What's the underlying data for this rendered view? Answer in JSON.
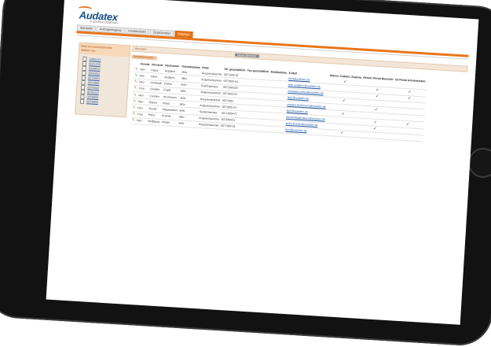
{
  "app": {
    "brand": "Audatex",
    "subtitle": "A SOLERA COMPANY"
  },
  "tabs": [
    "Startseite",
    "Auftragseingang",
    "Kundendaten",
    "Zusatzkosten",
    "Kataloge"
  ],
  "sidebar": {
    "header_line1": "Bitte bei untenstehenden",
    "header_line2": "Wählen Sie",
    "items": [
      "0000123",
      "0021235",
      "0036624",
      "0041053",
      "0072664",
      "0073305",
      "0074422",
      "0076313",
      "0078005",
      "0078899"
    ]
  },
  "main": {
    "panel_title": "Benutzer",
    "button_label": "Neuen Benutzer",
    "subheader": "Kontaktpersonen",
    "columns": [
      "",
      "Anrede",
      "Vorname",
      "Nachname",
      "Kontaktstatus",
      "Rolle",
      "Tel. geschäftlich",
      "Fax geschäftlich",
      "Mobiltelefon",
      "E-Mail",
      "Aktiver Audatex Zugang",
      "Aktiver Portal Benutzer",
      "Ist Portal Administrator"
    ],
    "rows": [
      {
        "anrede": "Herr",
        "vorname": "Klaus",
        "nachname": "Andljeric",
        "status": "aktiv",
        "rolle": "Ansprechpartner",
        "tel": "0071905-01",
        "email": "fsch@audatex.de",
        "a": true,
        "b": false,
        "c": false
      },
      {
        "anrede": "Herr",
        "vorname": "Hans",
        "nachname": "Andljeric",
        "status": "aktiv",
        "rolle": "Ansprechpartner",
        "tel": "0071905-01",
        "email": "web.andljeric@audatex.de",
        "a": false,
        "b": true,
        "c": true
      },
      {
        "anrede": "Herr",
        "vorname": "Christoph",
        "nachname": "Carlus",
        "status": "aktiv",
        "rolle": "Chefingenieur",
        "tel": "0071905287",
        "email": "christoph.carlus@audatex.de",
        "a": false,
        "b": true,
        "c": true
      },
      {
        "anrede": "Frau",
        "vorname": "Cordela",
        "nachname": "Engel",
        "status": "aktiv",
        "rolle": "Ansprechpartner",
        "tel": "0071905-01",
        "email": "fsch@audatex.de",
        "a": true,
        "b": false,
        "c": false
      },
      {
        "anrede": "Herr",
        "vorname": "Carsten",
        "nachname": "Hochmann",
        "status": "aktiv",
        "rolle": "Ansprechpartner",
        "tel": "0071905",
        "email": "carsten.hochmann@audatex.de",
        "a": false,
        "b": true,
        "c": false
      },
      {
        "anrede": "Herr",
        "vorname": "Rainer",
        "nachname": "Klaus",
        "status": "aktiv",
        "rolle": "Ansprechpartner",
        "tel": "0071905-01",
        "email": "fsch@audatex.de",
        "a": true,
        "b": false,
        "c": false
      },
      {
        "anrede": "Herr",
        "vorname": "Daniel",
        "nachname": "Klippenstein",
        "status": "aktiv",
        "rolle": "Systemberater",
        "tel": "0071905471",
        "email": "daniel.klippenstein@audatex.de",
        "a": false,
        "b": true,
        "c": true
      },
      {
        "anrede": "Frau",
        "vorname": "Petra",
        "nachname": "Kramer",
        "status": "aktiv",
        "rolle": "Ansprechpartner",
        "tel": "0071905S1",
        "email": "petra.kramer@audatex.de",
        "a": false,
        "b": true,
        "c": false
      },
      {
        "anrede": "Herr",
        "vorname": "Wolfgang",
        "nachname": "Krüger",
        "status": "aktiv",
        "rolle": "Ansprechpartner",
        "tel": "0071905-01",
        "email": "fsch@audatex.de",
        "a": true,
        "b": false,
        "c": false
      }
    ]
  },
  "colors": {
    "accent": "#e8761b",
    "brand_blue": "#1a4f86",
    "link": "#1f55a6",
    "tablet_frame": "#121212"
  },
  "icons": {
    "edit": "pencil-icon",
    "checkmark": "checkmark-icon",
    "home_button": "home-button"
  }
}
